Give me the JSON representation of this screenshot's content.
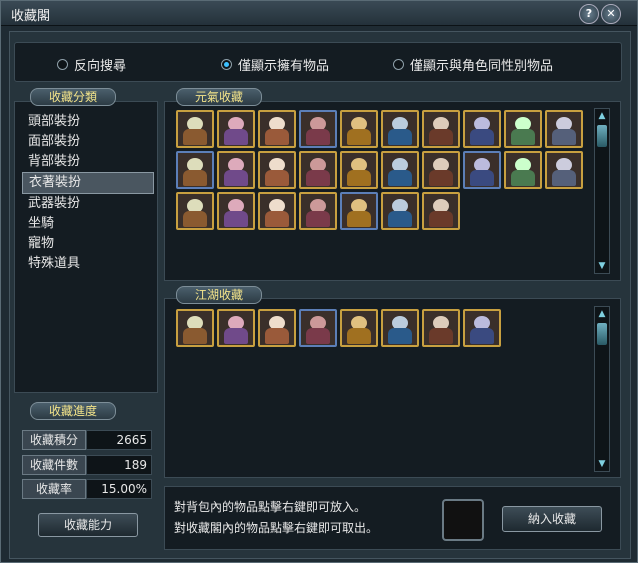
{
  "window": {
    "title": "收藏閣",
    "help_label": "?",
    "close_label": "✕"
  },
  "filters": [
    {
      "label": "反向搜尋",
      "selected": false
    },
    {
      "label": "僅顯示擁有物品",
      "selected": true
    },
    {
      "label": "僅顯示與角色同性別物品",
      "selected": false
    }
  ],
  "categories": {
    "tab_label": "收藏分類",
    "items": [
      "頭部裝扮",
      "面部裝扮",
      "背部裝扮",
      "衣著裝扮",
      "武器裝扮",
      "坐騎",
      "寵物",
      "特殊道具"
    ],
    "selected_index": 3
  },
  "progress": {
    "tab_label": "收藏進度",
    "rows": [
      {
        "label": "收藏積分",
        "value": "2665"
      },
      {
        "label": "收藏件數",
        "value": "189"
      },
      {
        "label": "收藏率",
        "value": "15.00%"
      }
    ],
    "ability_button": "收藏能力"
  },
  "sections": [
    {
      "tab_label": "元氣收藏",
      "item_count": 27
    },
    {
      "tab_label": "江湖收藏",
      "item_count": 8
    }
  ],
  "hints": [
    "對背包內的物品點擊右鍵即可放入。",
    "對收藏閣內的物品點擊右鍵即可取出。"
  ],
  "add_button": "納入收藏"
}
